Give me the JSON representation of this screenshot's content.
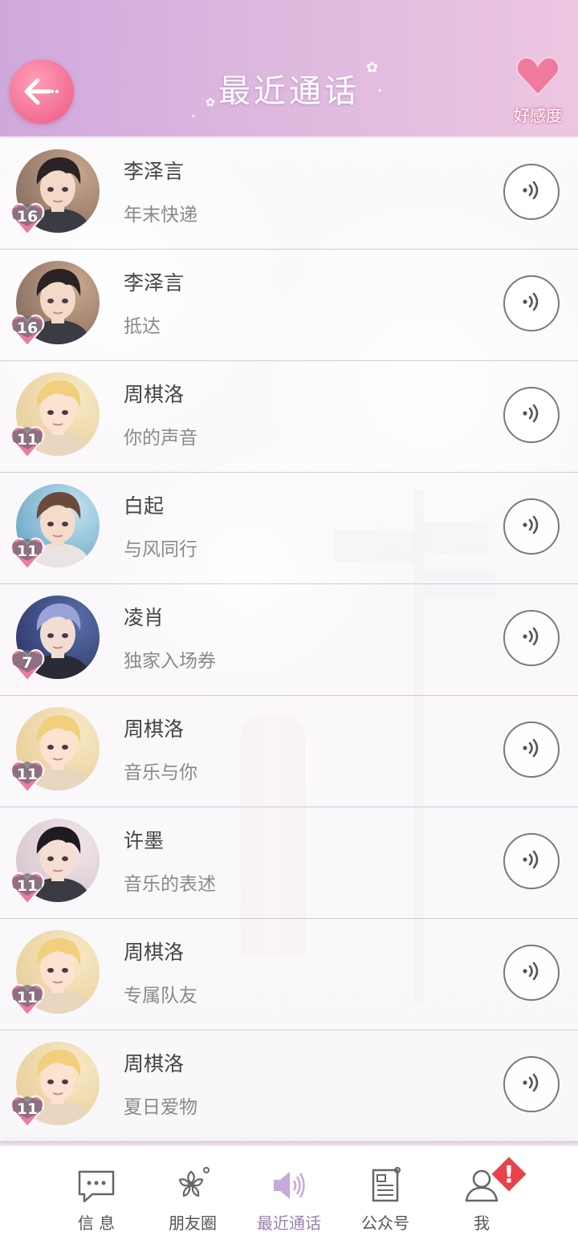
{
  "header": {
    "title": "最近通话",
    "favor_label": "好感度"
  },
  "calls": [
    {
      "name": "李泽言",
      "subtitle": "年末快递",
      "level": "16",
      "character": "lizeyan"
    },
    {
      "name": "李泽言",
      "subtitle": "抵达",
      "level": "16",
      "character": "lizeyan"
    },
    {
      "name": "周棋洛",
      "subtitle": "你的声音",
      "level": "11",
      "character": "zhouqiluo"
    },
    {
      "name": "白起",
      "subtitle": "与风同行",
      "level": "11",
      "character": "baiqi"
    },
    {
      "name": "凌肖",
      "subtitle": "独家入场券",
      "level": "7",
      "character": "lingxiao"
    },
    {
      "name": "周棋洛",
      "subtitle": "音乐与你",
      "level": "11",
      "character": "zhouqiluo"
    },
    {
      "name": "许墨",
      "subtitle": "音乐的表述",
      "level": "11",
      "character": "xumo"
    },
    {
      "name": "周棋洛",
      "subtitle": "专属队友",
      "level": "11",
      "character": "zhouqiluo"
    },
    {
      "name": "周棋洛",
      "subtitle": "夏日爱物",
      "level": "11",
      "character": "zhouqiluo"
    }
  ],
  "nav": [
    {
      "label": "信 息",
      "icon": "message-icon",
      "active": false
    },
    {
      "label": "朋友圈",
      "icon": "blossom-icon",
      "active": false
    },
    {
      "label": "最近通话",
      "icon": "speaker-icon",
      "active": true
    },
    {
      "label": "公众号",
      "icon": "document-icon",
      "active": false
    },
    {
      "label": "我",
      "icon": "user-icon",
      "active": false,
      "alert": "!"
    }
  ],
  "colors": {
    "header_start": "#cfa9dc",
    "header_end": "#ecc6e1",
    "back_button": "#f26d92",
    "heart_badge": "#f07a9e",
    "active_nav": "#9a7fb2",
    "alert_red": "#e8424a"
  }
}
